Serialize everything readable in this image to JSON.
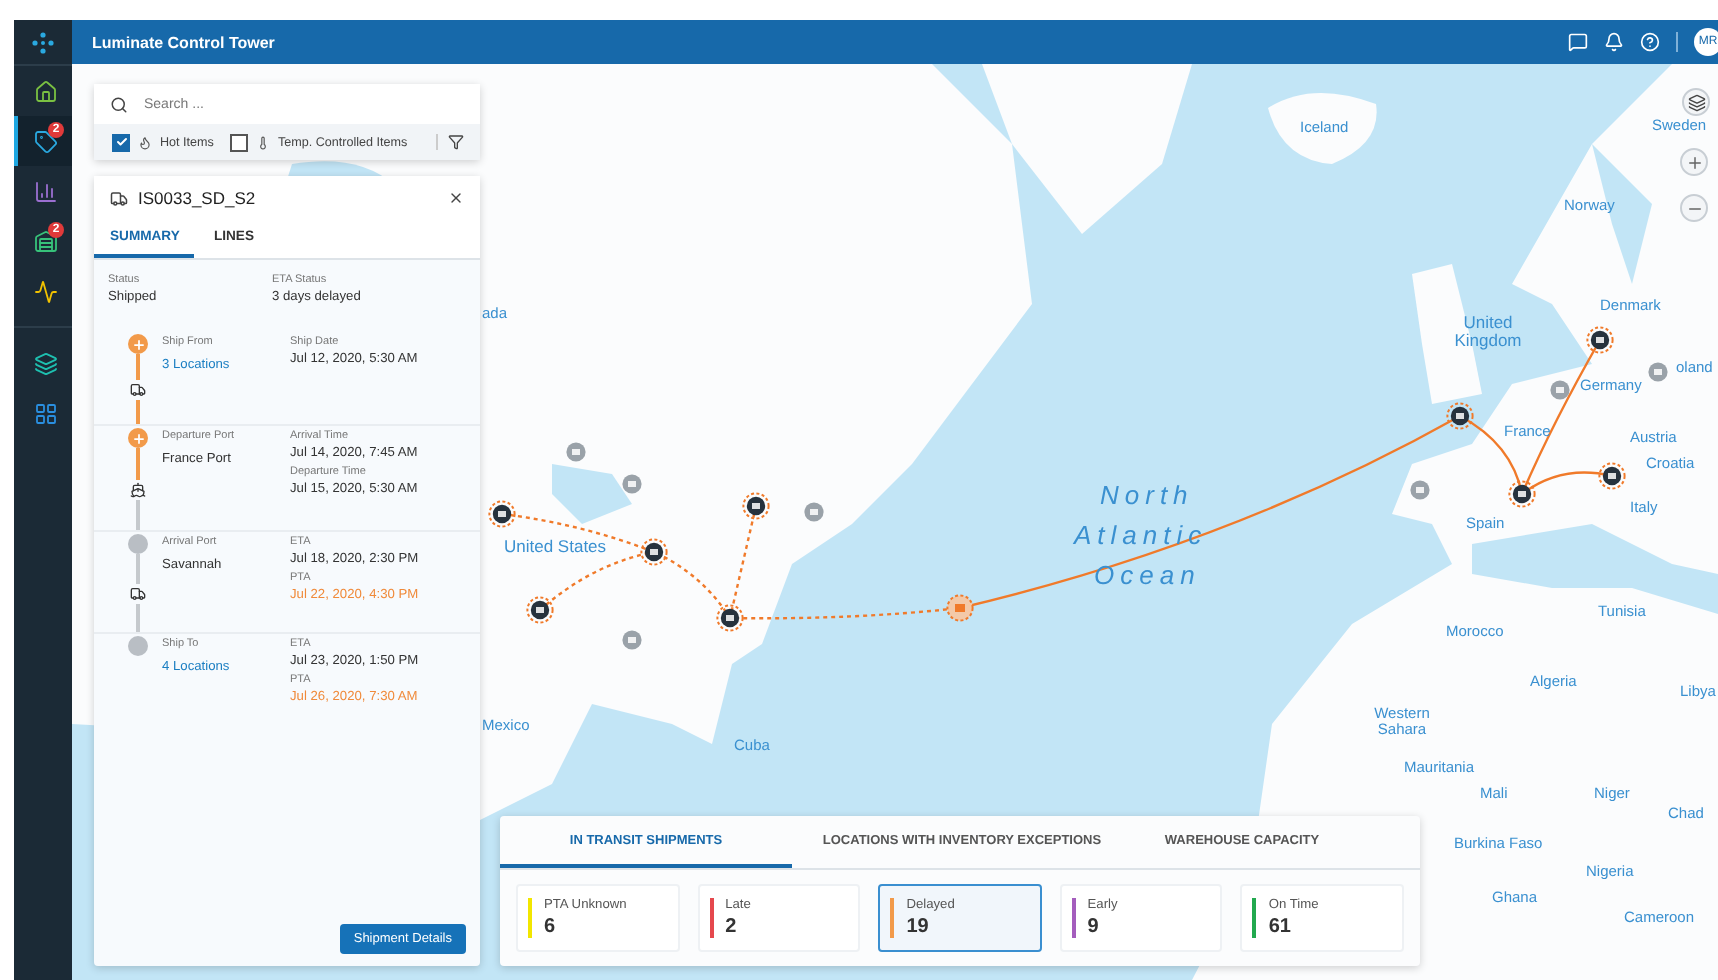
{
  "header": {
    "title": "Luminate Control Tower",
    "avatar": "MR"
  },
  "sidebar": {
    "items": [
      {
        "kind": "home",
        "selected": false
      },
      {
        "kind": "tag",
        "selected": true,
        "badge": "2"
      },
      {
        "kind": "chart",
        "selected": false
      },
      {
        "kind": "inventory",
        "selected": false,
        "badge": "2"
      },
      {
        "kind": "pulse",
        "selected": false
      },
      {
        "kind": "layers",
        "selected": false
      },
      {
        "kind": "apps",
        "selected": false
      }
    ]
  },
  "search": {
    "placeholder": "Search ...",
    "filters": [
      {
        "kind": "hot",
        "label": "Hot Items",
        "checked": true
      },
      {
        "kind": "temp",
        "label": "Temp. Controlled Items",
        "checked": false
      }
    ]
  },
  "shipment": {
    "id": "IS0033_SD_S2",
    "tabs": [
      {
        "label": "SUMMARY",
        "selected": true
      },
      {
        "label": "LINES",
        "selected": false
      }
    ],
    "status": [
      {
        "label": "Status",
        "value": "Shipped"
      },
      {
        "label": "ETA Status",
        "value": "3 days delayed"
      }
    ],
    "connectors": [
      {
        "kind": "truck"
      },
      {
        "kind": "ship"
      },
      {
        "kind": "truck"
      }
    ],
    "timeline": [
      {
        "label": "Ship From",
        "value": "3 Locations",
        "link": true,
        "reached": true,
        "details": [
          {
            "label": "Ship Date",
            "value": "Jul 12, 2020, 5:30 AM",
            "late": false
          }
        ]
      },
      {
        "label": "Departure Port",
        "value": "France Port",
        "link": false,
        "reached": true,
        "details": [
          {
            "label": "Arrival Time",
            "value": "Jul 14, 2020, 7:45 AM",
            "late": false
          },
          {
            "label": "Departure Time",
            "value": "Jul 15, 2020, 5:30 AM",
            "late": false
          }
        ]
      },
      {
        "label": "Arrival Port",
        "value": "Savannah",
        "link": false,
        "reached": false,
        "details": [
          {
            "label": "ETA",
            "value": "Jul 18, 2020, 2:30 PM",
            "late": false
          },
          {
            "label": "PTA",
            "value": "Jul 22, 2020, 4:30 PM",
            "late": true
          }
        ]
      },
      {
        "label": "Ship To",
        "value": "4 Locations",
        "link": true,
        "reached": false,
        "details": [
          {
            "label": "ETA",
            "value": "Jul 23, 2020, 1:50 PM",
            "late": false
          },
          {
            "label": "PTA",
            "value": "Jul 26, 2020, 7:30 AM",
            "late": true
          }
        ]
      }
    ],
    "button": "Shipment Details"
  },
  "map": {
    "labels": [
      "Iceland",
      "Sweden",
      "Norway",
      "Denmark",
      "United Kingdom",
      "Germany",
      "oland",
      "France",
      "Austria",
      "Croatia",
      "Italy",
      "Spain",
      "Tunisia",
      "Morocco",
      "Algeria",
      "Libya",
      "Western Sahara",
      "Mauritania",
      "Mali",
      "Niger",
      "Chad",
      "Burkina Faso",
      "Nigeria",
      "Ghana",
      "Cameroon",
      "ada",
      "United States",
      "Mexico",
      "Cuba"
    ],
    "ocean": [
      "North",
      "Atlantic",
      "Ocean"
    ]
  },
  "summary": {
    "tabs": [
      {
        "label": "IN TRANSIT SHIPMENTS",
        "selected": true
      },
      {
        "label": "LOCATIONS WITH INVENTORY EXCEPTIONS",
        "selected": false
      },
      {
        "label": "WAREHOUSE CAPACITY",
        "selected": false
      }
    ],
    "cards": [
      {
        "label": "PTA Unknown",
        "value": "6",
        "color": "#f2e600",
        "selected": false
      },
      {
        "label": "Late",
        "value": "2",
        "color": "#e5484d",
        "selected": false
      },
      {
        "label": "Delayed",
        "value": "19",
        "color": "#f29a4a",
        "selected": true
      },
      {
        "label": "Early",
        "value": "9",
        "color": "#a45dbd",
        "selected": false
      },
      {
        "label": "On Time",
        "value": "61",
        "color": "#22a94f",
        "selected": false
      }
    ]
  }
}
